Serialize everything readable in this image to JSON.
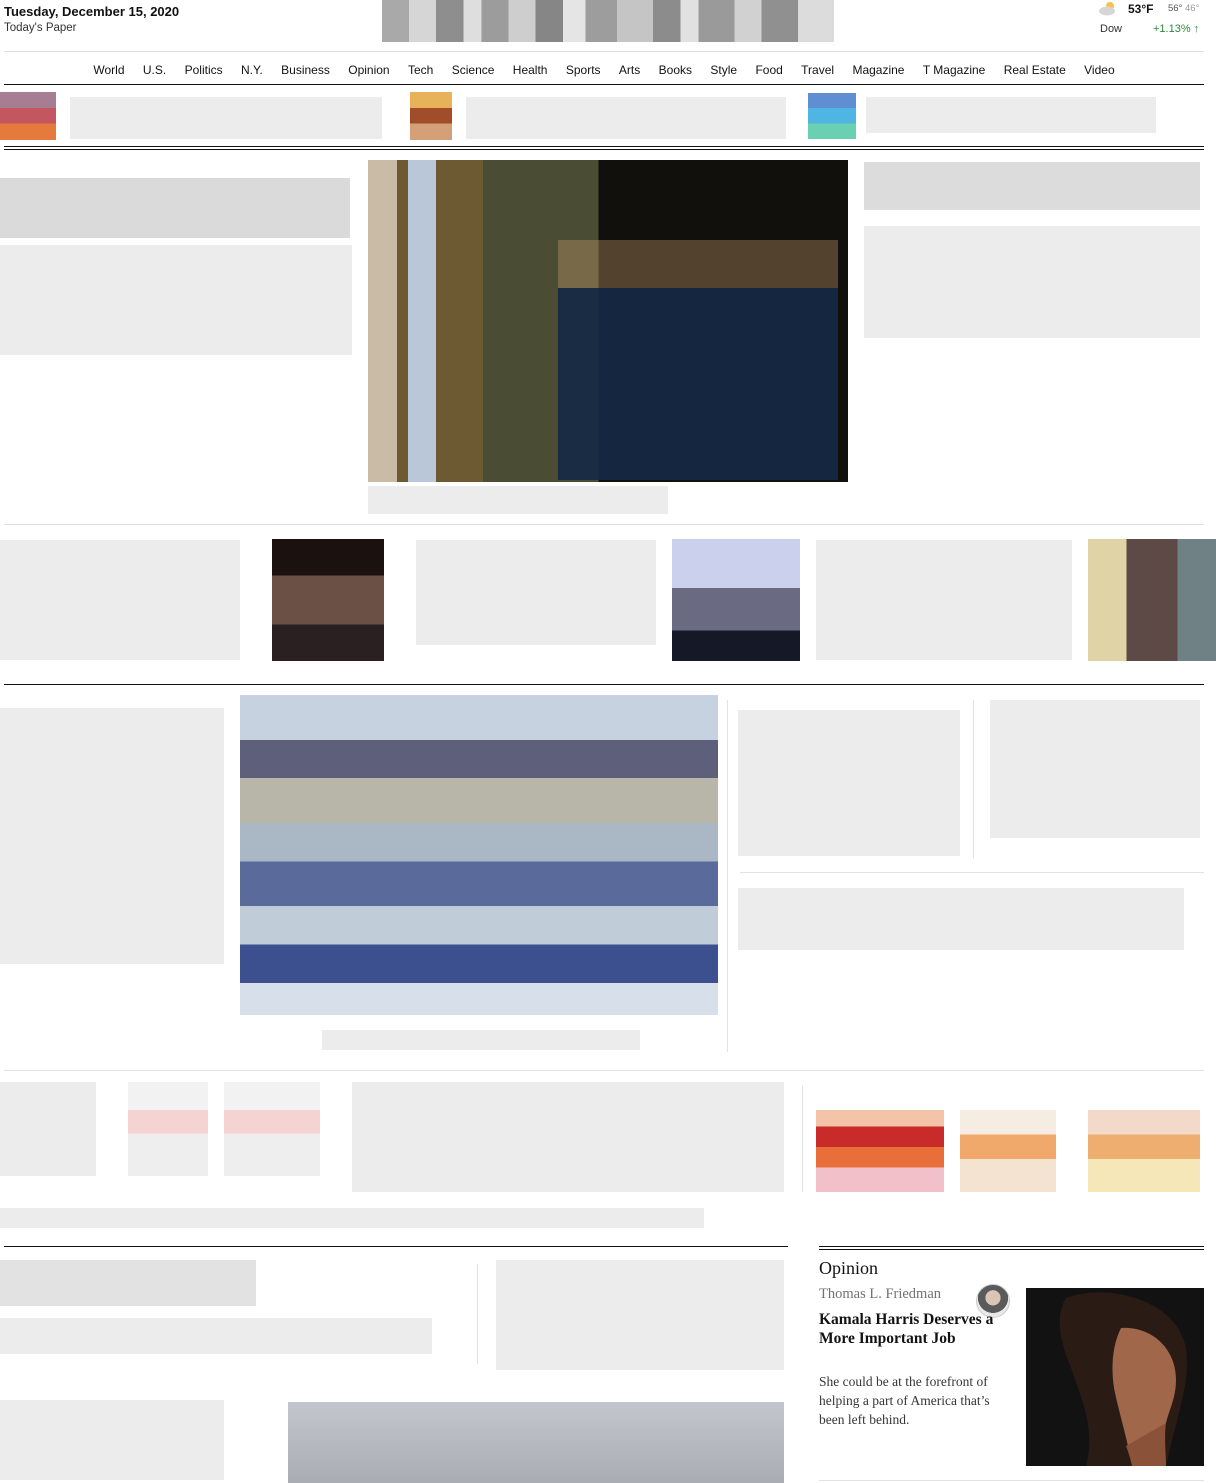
{
  "header": {
    "date": "Tuesday, December 15, 2020",
    "todays_paper": "Today's Paper",
    "weather": {
      "temp": "53°F",
      "high": "56°",
      "low": "46°",
      "icon": "partly-cloudy-icon"
    },
    "market": {
      "label": "Dow",
      "change": "+1.13% ↑",
      "change_color": "#2d8a3e"
    }
  },
  "nav": [
    "World",
    "U.S.",
    "Politics",
    "N.Y.",
    "Business",
    "Opinion",
    "Tech",
    "Science",
    "Health",
    "Sports",
    "Arts",
    "Books",
    "Style",
    "Food",
    "Travel",
    "Magazine",
    "T Magazine",
    "Real Estate",
    "Video"
  ],
  "opinion": {
    "section_label": "Opinion",
    "author": "Thomas L. Friedman",
    "headline": "Kamala Harris Deserves a More Important Job",
    "summary": "She could be at the forefront of helping a part of America that’s been left behind."
  }
}
